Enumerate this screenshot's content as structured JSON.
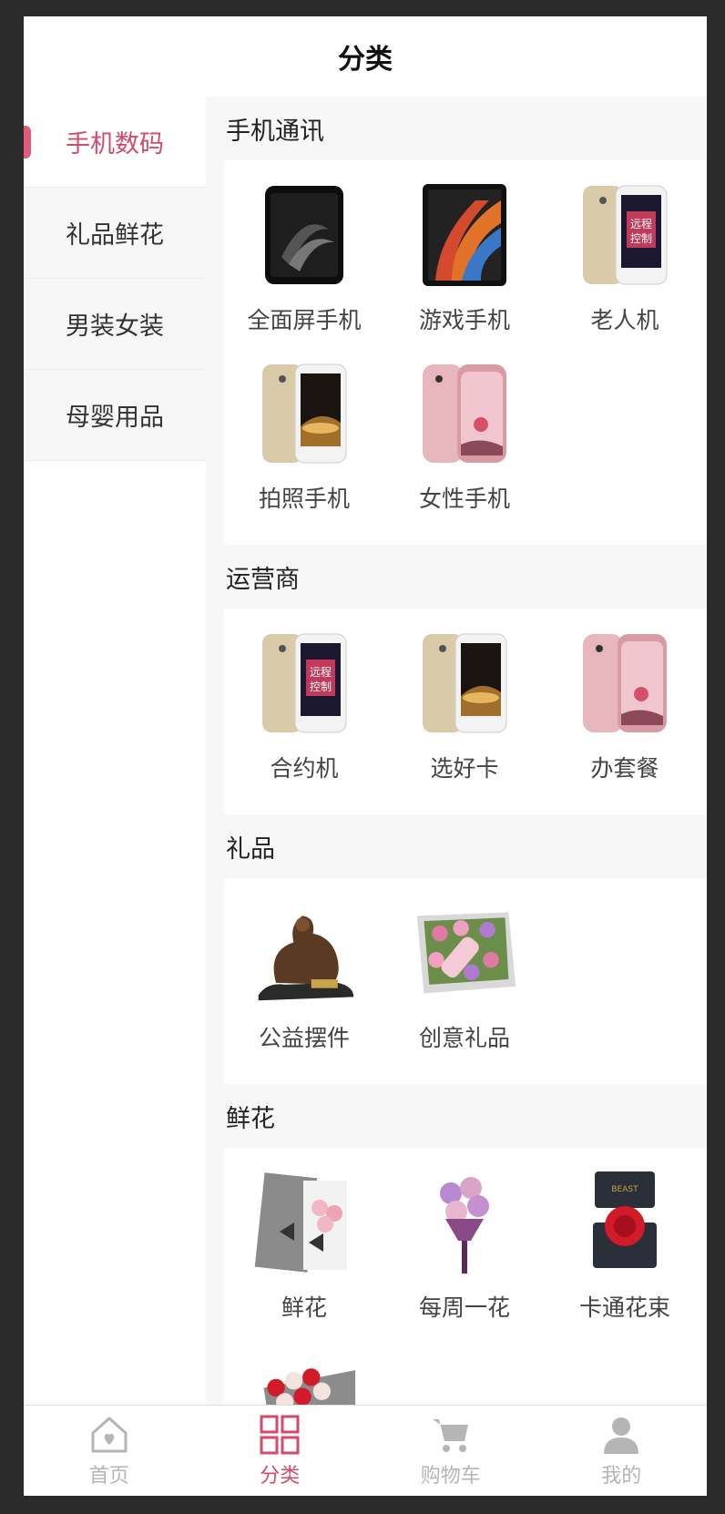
{
  "header": {
    "title": "分类"
  },
  "sidebar": {
    "items": [
      {
        "label": "手机数码"
      },
      {
        "label": "礼品鲜花"
      },
      {
        "label": "男装女装"
      },
      {
        "label": "母婴用品"
      }
    ]
  },
  "sections": [
    {
      "title": "手机通讯",
      "items": [
        {
          "label": "全面屏手机",
          "icon": "black-phone-image"
        },
        {
          "label": "游戏手机",
          "icon": "colorful-phone-image"
        },
        {
          "label": "老人机",
          "icon": "remote-control-phone-image"
        },
        {
          "label": "拍照手机",
          "icon": "gold-phone-image"
        },
        {
          "label": "女性手机",
          "icon": "pink-phone-image"
        }
      ]
    },
    {
      "title": "运营商",
      "items": [
        {
          "label": "合约机",
          "icon": "remote-control-phone-image"
        },
        {
          "label": "选好卡",
          "icon": "gold-phone-image"
        },
        {
          "label": "办套餐",
          "icon": "pink-phone-image"
        }
      ]
    },
    {
      "title": "礼品",
      "items": [
        {
          "label": "公益摆件",
          "icon": "pixiu-statue-image"
        },
        {
          "label": "创意礼品",
          "icon": "flower-gift-box-image"
        }
      ]
    },
    {
      "title": "鲜花",
      "items": [
        {
          "label": "鲜花",
          "icon": "flower-box-image"
        },
        {
          "label": "每周一花",
          "icon": "bouquet-image"
        },
        {
          "label": "卡通花束",
          "icon": "rose-box-image"
        },
        {
          "label": "",
          "icon": "red-roses-box-image"
        }
      ]
    }
  ],
  "tabbar": {
    "items": [
      {
        "label": "首页",
        "icon": "home-icon"
      },
      {
        "label": "分类",
        "icon": "grid-icon"
      },
      {
        "label": "购物车",
        "icon": "cart-icon"
      },
      {
        "label": "我的",
        "icon": "user-icon"
      }
    ]
  },
  "colors": {
    "accent": "#d44a6b",
    "inactive": "#b5b5b5"
  }
}
